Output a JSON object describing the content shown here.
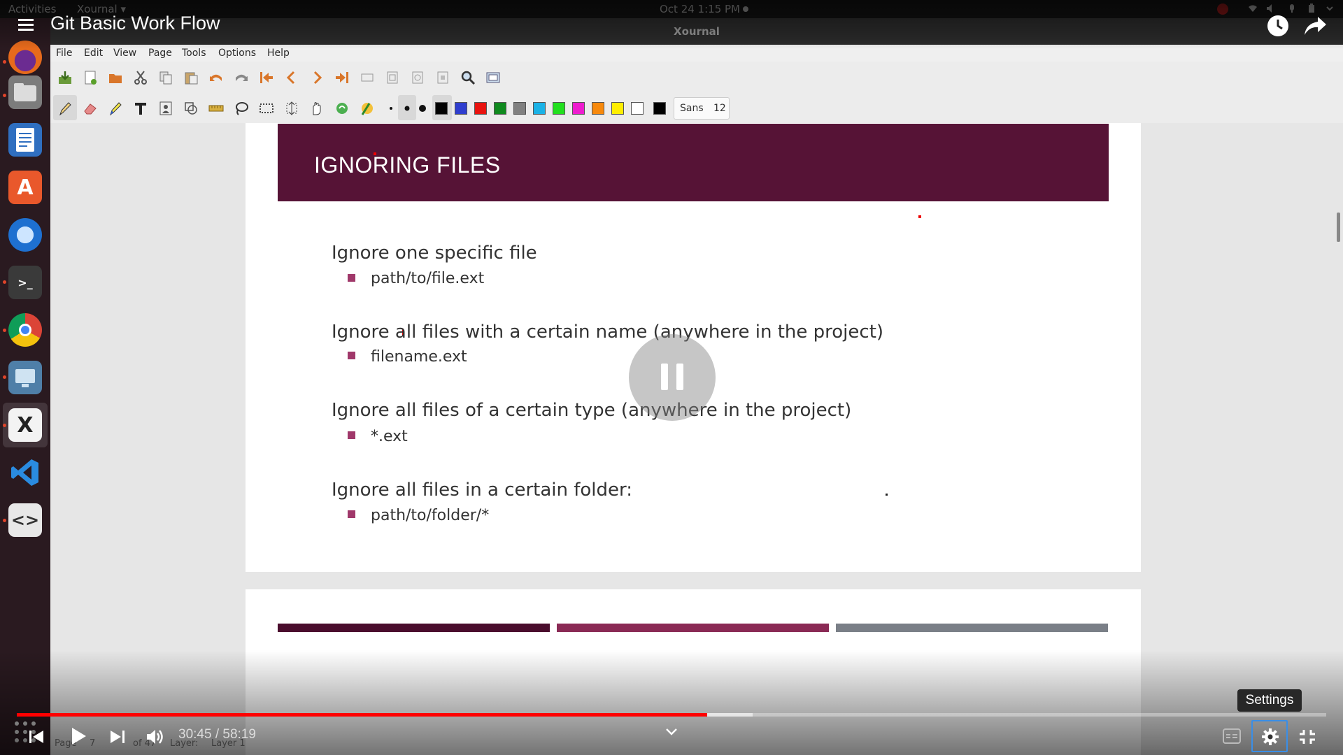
{
  "topbar": {
    "activities": "Activities",
    "app_name": "Xournal ▾",
    "clock": "Oct 24  1:15 PM"
  },
  "window": {
    "title": "Xournal"
  },
  "video": {
    "title": "Git Basic Work Flow",
    "current_time": "30:45",
    "duration": "58:19",
    "time_display": "30:45 / 58:19",
    "progress_fraction": 0.527,
    "buffered_fraction": 0.562,
    "settings_tooltip": "Settings",
    "state": "paused"
  },
  "menu": [
    "File",
    "Edit",
    "View",
    "Page",
    "Tools",
    "Options",
    "Help"
  ],
  "toolbar": {
    "font_name": "Sans",
    "font_size": "12",
    "colors": [
      "#000000",
      "#2f3ecf",
      "#e8130f",
      "#0f8a1e",
      "#808080",
      "#1ab2e6",
      "#22e01e",
      "#ee1ccf",
      "#f7890c",
      "#ffee00",
      "#ffffff",
      "#000000"
    ]
  },
  "slide": {
    "title": "IGNORING FILES",
    "sections": [
      {
        "heading": "Ignore one specific file",
        "item": "path/to/file.ext"
      },
      {
        "heading": "Ignore all files with a certain name (anywhere in the project)",
        "item": "filename.ext"
      },
      {
        "heading": "Ignore all files of a certain type (anywhere in the project)",
        "item": " *.ext"
      },
      {
        "heading": "Ignore all files in a certain folder:",
        "item": "path/to/folder/*"
      }
    ],
    "accent_colors": [
      "#561336",
      "#a0386a"
    ]
  },
  "statusbar": {
    "page_label": "Page",
    "page_value": "7",
    "page_of": "of 47",
    "layer_label": "Layer:",
    "layer_value": "Layer 1"
  }
}
